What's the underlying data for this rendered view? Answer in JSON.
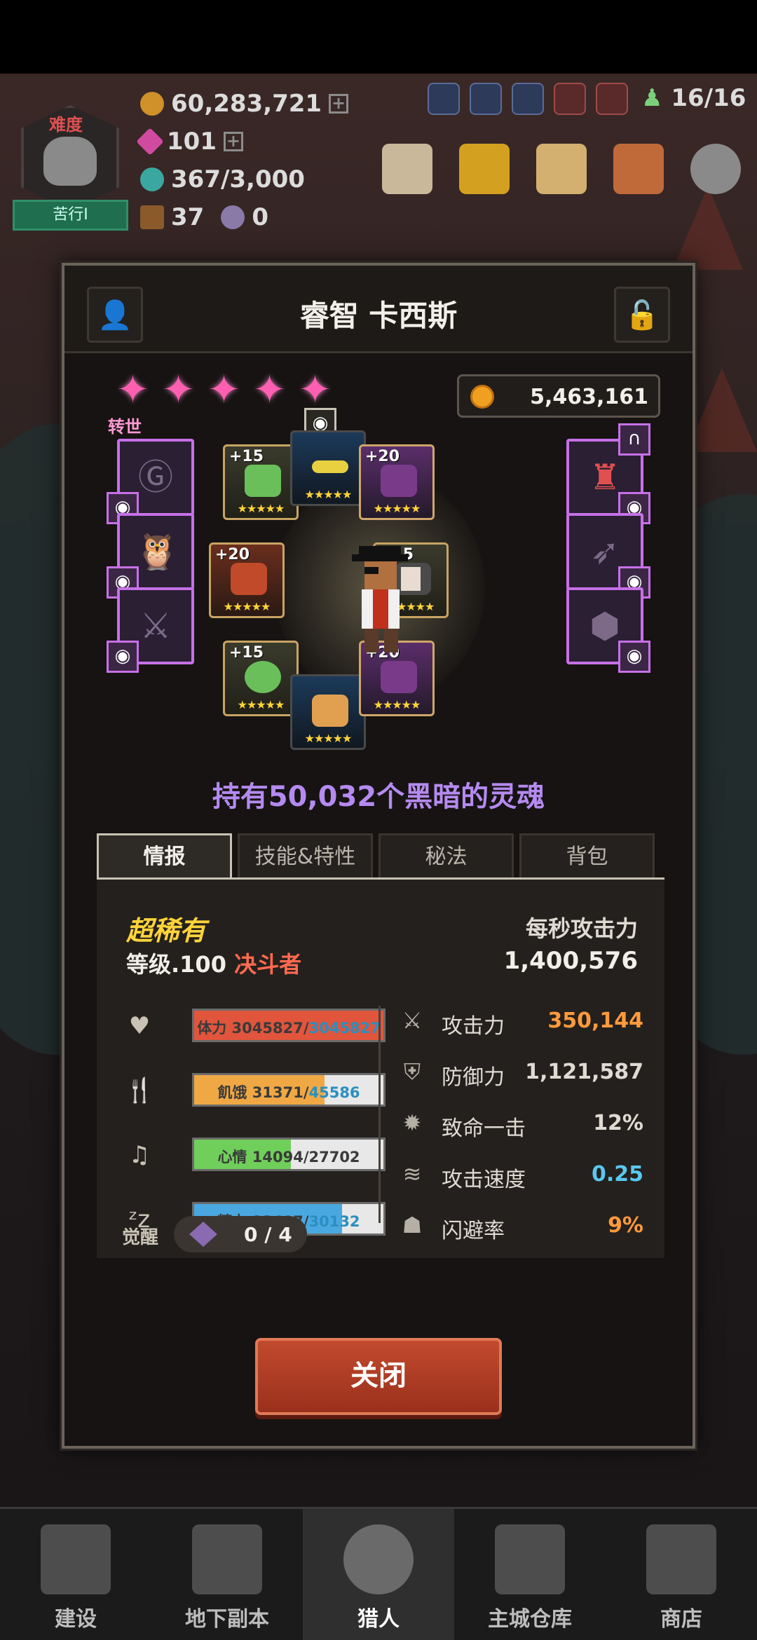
{
  "hud": {
    "gold": "60,283,721",
    "gems": "101",
    "soul_stones": "367/3,000",
    "chests": "37",
    "orbs": "0",
    "hunters": "16/16",
    "difficulty_label": "难度",
    "difficulty_level": "苦行I"
  },
  "modal": {
    "title": "睿智 卡西斯",
    "rebirth_label": "转世",
    "star_count": 5,
    "gold_value": "5,463,161",
    "souls_text": "持有50,032个黑暗的灵魂",
    "equipment": [
      {
        "slot": "necklace",
        "level": "+15",
        "stars": "★★★★★"
      },
      {
        "slot": "helmet",
        "level": "",
        "stars": "★★★★★"
      },
      {
        "slot": "armor",
        "level": "+20",
        "stars": "★★★★★"
      },
      {
        "slot": "weapon",
        "level": "+20",
        "stars": "★★★★★"
      },
      {
        "slot": "gloves",
        "level": "+15",
        "stars": "★★★★★"
      },
      {
        "slot": "ring",
        "level": "+15",
        "stars": "★★★★★"
      },
      {
        "slot": "food",
        "level": "",
        "stars": "★★★★★"
      },
      {
        "slot": "boots",
        "level": "+20",
        "stars": "★★★★★"
      }
    ],
    "tabs": [
      "情报",
      "技能&特性",
      "秘法",
      "背包"
    ],
    "rarity": "超稀有",
    "level_prefix": "等级.100",
    "class_name": "决斗者",
    "dps_label": "每秒攻击力",
    "dps_value": "1,400,576",
    "bars": [
      {
        "name": "hp",
        "label": "体力",
        "current": "3045827",
        "max": "3045827",
        "ratio": 1.0,
        "color": "#e0553c"
      },
      {
        "name": "hunger",
        "label": "飢饿",
        "current": "31371",
        "max": "45586",
        "ratio": 0.69,
        "color": "#f0a845"
      },
      {
        "name": "mood",
        "label": "心情",
        "current": "14094",
        "max": "27702",
        "ratio": 0.51,
        "color": "#6fcf5a"
      },
      {
        "name": "energy",
        "label": "精力",
        "current": "23417",
        "max": "30132",
        "ratio": 0.78,
        "color": "#4aa8e0"
      }
    ],
    "stats": [
      {
        "label": "攻击力",
        "value": "350,144",
        "color": "#ff9a3c"
      },
      {
        "label": "防御力",
        "value": "1,121,587",
        "color": "#e0dbd2"
      },
      {
        "label": "致命一击",
        "value": "12%",
        "color": "#e0dbd2"
      },
      {
        "label": "攻击速度",
        "value": "0.25",
        "color": "#5ac8f0"
      },
      {
        "label": "闪避率",
        "value": "9%",
        "color": "#ff9a3c"
      }
    ],
    "awaken_label": "觉醒",
    "awaken_value": "0 / 4",
    "close_label": "关闭"
  },
  "nav": [
    {
      "label": "建设"
    },
    {
      "label": "地下副本"
    },
    {
      "label": "猎人"
    },
    {
      "label": "主城仓库"
    },
    {
      "label": "商店"
    }
  ]
}
